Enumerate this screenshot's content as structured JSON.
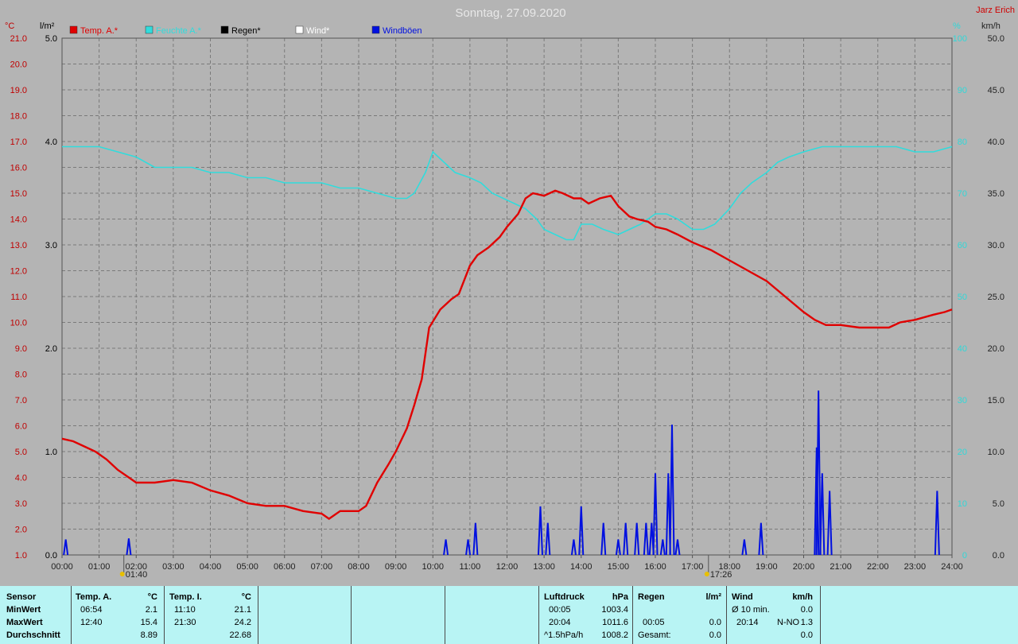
{
  "title": "Sonntag, 27.09.2020",
  "author": "Jarz Erich",
  "colors": {
    "temp": "#e00000",
    "humidity": "#30dcdc",
    "rain": "#000000",
    "wind": "#ffffff",
    "gusts": "#0010e0",
    "left_axis": "#c00000",
    "right_axis": "#30d8d8",
    "background": "#b4b4b4",
    "panel": "#b8f4f4"
  },
  "chart_data": {
    "type": "line",
    "title": "Sonntag, 27.09.2020",
    "grid": true,
    "legend_position": "top-left",
    "axes": {
      "temp": {
        "unit": "°C",
        "range": [
          1.0,
          21.0
        ]
      },
      "rain": {
        "unit": "l/m²",
        "range": [
          0.0,
          5.0
        ]
      },
      "humidity": {
        "unit": "%",
        "range": [
          0,
          100
        ]
      },
      "wind": {
        "unit": "km/h",
        "range": [
          0.0,
          50.0
        ]
      }
    },
    "x_ticks": [
      "00:00",
      "01:00",
      "02:00",
      "03:00",
      "04:00",
      "05:00",
      "06:00",
      "07:00",
      "08:00",
      "09:00",
      "10:00",
      "11:00",
      "12:00",
      "13:00",
      "14:00",
      "15:00",
      "16:00",
      "17:00",
      "18:00",
      "19:00",
      "20:00",
      "21:00",
      "22:00",
      "23:00",
      "24:00"
    ],
    "temp_ticks": [
      "1.0",
      "2.0",
      "3.0",
      "4.0",
      "5.0",
      "6.0",
      "7.0",
      "8.0",
      "9.0",
      "10.0",
      "11.0",
      "12.0",
      "13.0",
      "14.0",
      "15.0",
      "16.0",
      "17.0",
      "18.0",
      "19.0",
      "20.0",
      "21.0"
    ],
    "rain_ticks": [
      "0.0",
      "1.0",
      "2.0",
      "3.0",
      "4.0",
      "5.0"
    ],
    "humidity_ticks": [
      "0",
      "10",
      "20",
      "30",
      "40",
      "50",
      "60",
      "70",
      "80",
      "90",
      "100"
    ],
    "wind_ticks": [
      "0.0",
      "5.0",
      "10.0",
      "15.0",
      "20.0",
      "25.0",
      "30.0",
      "35.0",
      "40.0",
      "45.0",
      "50.0"
    ],
    "legend": [
      "Temp. A.*",
      "Feuchte A.*",
      "Regen*",
      "Wind*",
      "Windböen"
    ],
    "markers": [
      {
        "hour": 1.667,
        "label": "01:40"
      },
      {
        "hour": 17.433,
        "label": "17:26"
      }
    ],
    "series": [
      {
        "name": "Temp. A.",
        "axis": "temp",
        "unit": "°C",
        "x": [
          0,
          0.3,
          0.6,
          0.9,
          1.2,
          1.5,
          1.8,
          2.0,
          2.5,
          3.0,
          3.5,
          4.0,
          4.5,
          5.0,
          5.5,
          6.0,
          6.5,
          7.0,
          7.2,
          7.5,
          8.0,
          8.2,
          8.5,
          8.8,
          9.0,
          9.3,
          9.5,
          9.7,
          9.9,
          10.2,
          10.5,
          10.7,
          11.0,
          11.2,
          11.5,
          11.8,
          12.0,
          12.3,
          12.5,
          12.7,
          13.0,
          13.3,
          13.5,
          13.8,
          14.0,
          14.2,
          14.5,
          14.8,
          15.0,
          15.3,
          15.5,
          15.8,
          16.0,
          16.3,
          16.6,
          17.0,
          17.5,
          18.0,
          18.5,
          19.0,
          19.5,
          20.0,
          20.3,
          20.6,
          21.0,
          21.5,
          22.0,
          22.3,
          22.6,
          23.0,
          23.5,
          23.8,
          24.0
        ],
        "y": [
          5.5,
          5.4,
          5.2,
          5.0,
          4.7,
          4.3,
          4.0,
          3.8,
          3.8,
          3.9,
          3.8,
          3.5,
          3.3,
          3.0,
          2.9,
          2.9,
          2.7,
          2.6,
          2.4,
          2.7,
          2.7,
          2.9,
          3.8,
          4.5,
          5.0,
          5.9,
          6.8,
          7.8,
          9.8,
          10.5,
          10.9,
          11.1,
          12.2,
          12.6,
          12.9,
          13.3,
          13.7,
          14.2,
          14.8,
          15.0,
          14.9,
          15.1,
          15.0,
          14.8,
          14.8,
          14.6,
          14.8,
          14.9,
          14.5,
          14.1,
          14.0,
          13.9,
          13.7,
          13.6,
          13.4,
          13.1,
          12.8,
          12.4,
          12.0,
          11.6,
          11.0,
          10.4,
          10.1,
          9.9,
          9.9,
          9.8,
          9.8,
          9.8,
          10.0,
          10.1,
          10.3,
          10.4,
          10.5
        ]
      },
      {
        "name": "Feuchte A.",
        "axis": "humidity",
        "unit": "%",
        "x": [
          0,
          0.5,
          1.0,
          1.5,
          2.0,
          2.5,
          3.0,
          3.5,
          4.0,
          4.5,
          5.0,
          5.5,
          6.0,
          6.5,
          7.0,
          7.5,
          8.0,
          8.5,
          9.0,
          9.3,
          9.5,
          9.8,
          10.0,
          10.3,
          10.6,
          11.0,
          11.3,
          11.6,
          11.9,
          12.2,
          12.5,
          12.8,
          13.0,
          13.3,
          13.6,
          13.8,
          14.0,
          14.3,
          14.6,
          15.0,
          15.3,
          15.6,
          15.8,
          16.0,
          16.3,
          16.6,
          17.0,
          17.3,
          17.6,
          18.0,
          18.3,
          18.6,
          19.0,
          19.3,
          19.6,
          20.0,
          20.5,
          21.0,
          21.5,
          22.0,
          22.5,
          23.0,
          23.5,
          24.0
        ],
        "y": [
          79,
          79,
          79,
          78,
          77,
          75,
          75,
          75,
          74,
          74,
          73,
          73,
          72,
          72,
          72,
          71,
          71,
          70,
          69,
          69,
          70,
          74,
          78,
          76,
          74,
          73,
          72,
          70,
          69,
          68,
          67,
          65,
          63,
          62,
          61,
          61,
          64,
          64,
          63,
          62,
          63,
          64,
          65,
          66,
          66,
          65,
          63,
          63,
          64,
          67,
          70,
          72,
          74,
          76,
          77,
          78,
          79,
          79,
          79,
          79,
          79,
          78,
          78,
          79
        ]
      }
    ],
    "gust_events": [
      {
        "x": 0.1,
        "y": 1.5
      },
      {
        "x": 1.8,
        "y": 1.6
      },
      {
        "x": 10.35,
        "y": 1.5
      },
      {
        "x": 10.95,
        "y": 1.5
      },
      {
        "x": 11.15,
        "y": 3.1
      },
      {
        "x": 12.9,
        "y": 4.7
      },
      {
        "x": 13.1,
        "y": 3.1
      },
      {
        "x": 13.8,
        "y": 1.5
      },
      {
        "x": 14.0,
        "y": 4.7
      },
      {
        "x": 14.6,
        "y": 3.1
      },
      {
        "x": 15.0,
        "y": 1.5
      },
      {
        "x": 15.2,
        "y": 3.1
      },
      {
        "x": 15.5,
        "y": 3.1
      },
      {
        "x": 15.75,
        "y": 3.1
      },
      {
        "x": 15.9,
        "y": 3.1
      },
      {
        "x": 16.0,
        "y": 7.9
      },
      {
        "x": 16.2,
        "y": 1.5
      },
      {
        "x": 16.35,
        "y": 7.9
      },
      {
        "x": 16.45,
        "y": 12.6
      },
      {
        "x": 16.6,
        "y": 1.5
      },
      {
        "x": 18.4,
        "y": 1.5
      },
      {
        "x": 18.85,
        "y": 3.1
      },
      {
        "x": 20.35,
        "y": 10.4
      },
      {
        "x": 20.4,
        "y": 15.9
      },
      {
        "x": 20.5,
        "y": 7.9
      },
      {
        "x": 20.7,
        "y": 6.2
      },
      {
        "x": 23.6,
        "y": 6.2
      }
    ]
  },
  "panel": {
    "sensor": {
      "header": "Sensor",
      "rows": [
        "MinWert",
        "MaxWert",
        "Durchschnitt"
      ]
    },
    "temp_a": {
      "header": "Temp. A.",
      "unit": "°C",
      "min_time": "06:54",
      "min_val": "2.1",
      "max_time": "12:40",
      "max_val": "15.4",
      "avg": "8.89"
    },
    "temp_i": {
      "header": "Temp. I.",
      "unit": "°C",
      "min_time": "11:10",
      "min_val": "21.1",
      "max_time": "21:30",
      "max_val": "24.2",
      "avg": "22.68"
    },
    "pressure": {
      "header": "Luftdruck",
      "unit": "hPa",
      "min_time": "00:05",
      "min_val": "1003.4",
      "max_time": "20:04",
      "max_val": "1011.6",
      "trend_label": "^1.5hPa/h",
      "trend_val": "1008.2"
    },
    "rain": {
      "header": "Regen",
      "unit": "l/m²",
      "time": "00:05",
      "val": "0.0",
      "total_label": "Gesamt:",
      "total_val": "0.0"
    },
    "wind": {
      "header": "Wind",
      "unit": "km/h",
      "avg_label": "Ø 10 min.",
      "avg_val": "0.0",
      "max_time": "20:14",
      "max_dir": "N-NO",
      "max_val": "1.3",
      "avg2_val": "0.0"
    }
  }
}
